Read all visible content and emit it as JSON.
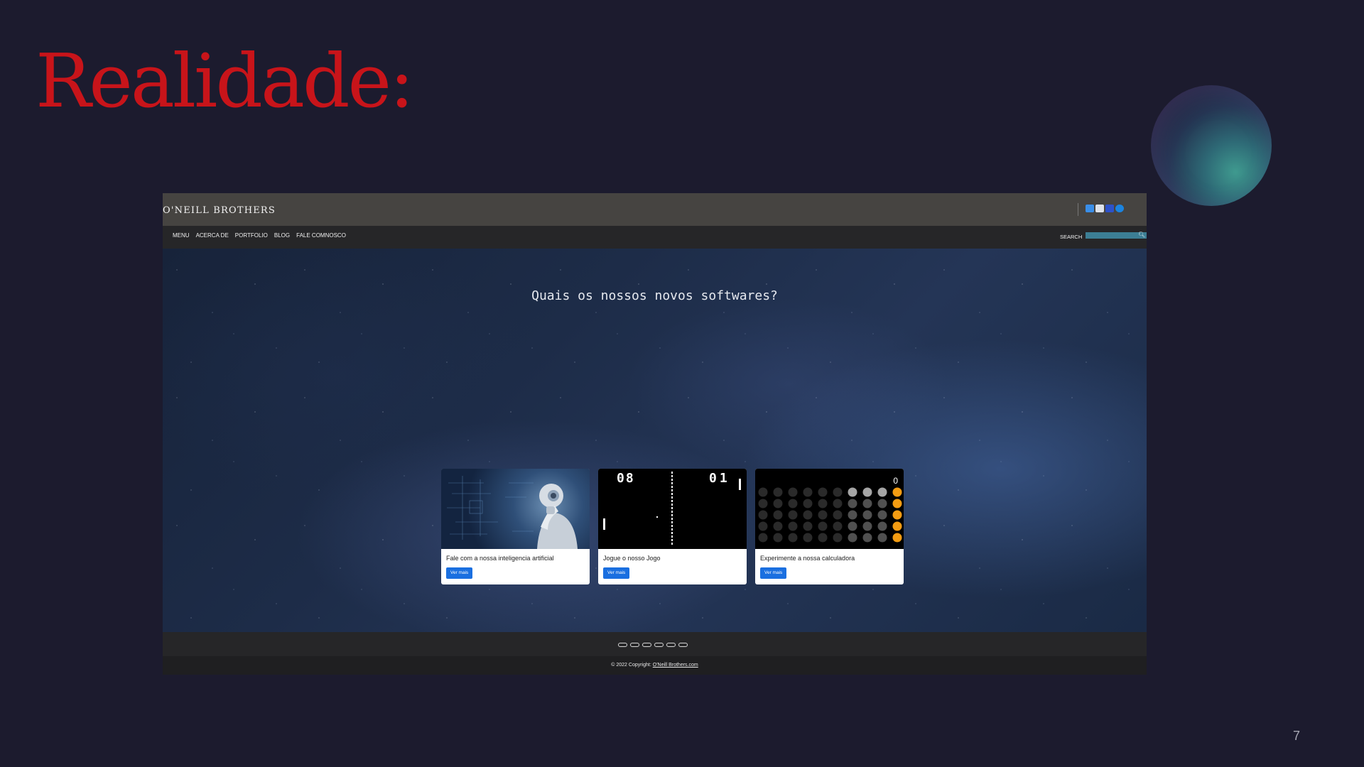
{
  "slide": {
    "title": "Realidade:",
    "page_number": "7",
    "colors": {
      "background": "#1c1b2e",
      "title": "#c8141a"
    }
  },
  "site": {
    "brand": "O'NEILL BROTHERS",
    "social_icons": [
      "delicious-icon",
      "mail-icon",
      "flickr-icon",
      "skype-icon"
    ],
    "nav": {
      "items": [
        {
          "label": "MENU"
        },
        {
          "label": "ACERCA DE"
        },
        {
          "label": "PORTFOLIO"
        },
        {
          "label": "BLOG"
        },
        {
          "label": "FALE COMNOSCO"
        }
      ],
      "search_label": "SEARCH",
      "search_value": "",
      "search_icon": "magnifier-icon"
    },
    "hero": {
      "title": "Quais os nossos novos softwares?"
    },
    "cards": [
      {
        "image": "robot-thinking",
        "text": "Fale com a nossa inteligencia artificial",
        "button": "Ver mais"
      },
      {
        "image": "pong-game",
        "text": "Jogue o nosso Jogo",
        "button": "Ver mais",
        "score_left": "08",
        "score_right": "01"
      },
      {
        "image": "calculator",
        "text": "Experimente a nossa calculadora",
        "button": "Ver mais",
        "display": "0"
      }
    ],
    "carousel_dots": 6,
    "footer": {
      "copyright_prefix": "© 2022 Copyright:",
      "copyright_link": "O'Neill Brothers.com"
    },
    "colors": {
      "header": "#464441",
      "nav": "#262628",
      "button": "#1a6fe0",
      "search": "#3c7e94",
      "calc_accent": "#f39c12"
    }
  }
}
